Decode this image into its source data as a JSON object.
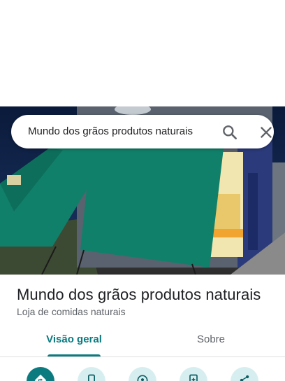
{
  "search": {
    "query": "Mundo dos grãos produtos naturais"
  },
  "place": {
    "name": "Mundo dos grãos produtos naturais",
    "category": "Loja de comidas naturais"
  },
  "tabs": [
    {
      "label": "Visão geral",
      "active": true
    },
    {
      "label": "Sobre",
      "active": false
    }
  ],
  "actions": [
    {
      "icon": "directions-icon"
    },
    {
      "icon": "phone-icon"
    },
    {
      "icon": "place-icon"
    },
    {
      "icon": "add-photo-icon"
    },
    {
      "icon": "share-icon"
    }
  ],
  "colors": {
    "accent": "#0b7b80",
    "accent_light": "#d7eef0",
    "awning_green": "#11806a"
  }
}
